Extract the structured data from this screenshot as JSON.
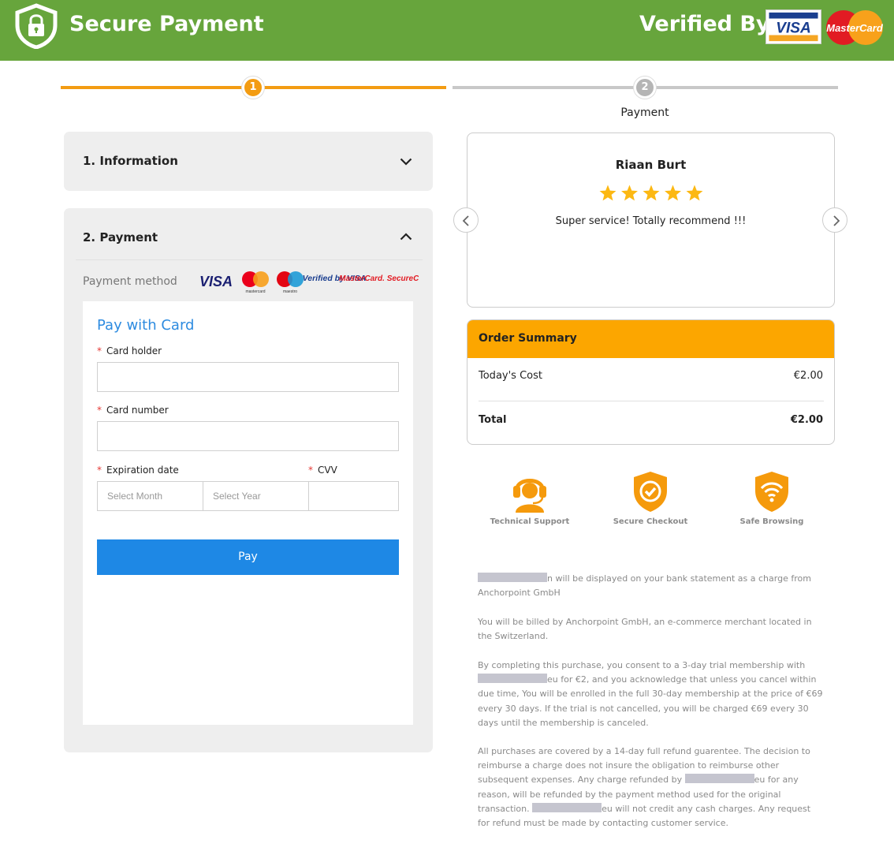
{
  "header": {
    "title": "Secure Payment",
    "verified_by": "Verified By",
    "visa_logo": "VISA",
    "mastercard_logo": "MasterCard",
    "color": "#67a53c"
  },
  "stepper": {
    "steps": [
      {
        "number": "1",
        "label": "",
        "state": "active",
        "color": "#f39c12"
      },
      {
        "number": "2",
        "label": "Payment",
        "state": "inactive",
        "color": "#bdbdbd"
      }
    ]
  },
  "accordion": {
    "information_title": "1. Information",
    "payment_title": "2. Payment",
    "payment_method_label": "Payment method",
    "method_logos": [
      "VISA",
      "mastercard",
      "maestro",
      "Verified by VISA",
      "MasterCard. SecureCode."
    ]
  },
  "card_form": {
    "title": "Pay with Card",
    "required_mark": "*",
    "card_holder_label": "Card holder",
    "card_holder_value": "",
    "card_number_label": "Card number",
    "card_number_value": "",
    "expiration_label": "Expiration date",
    "month_placeholder": "Select Month",
    "year_placeholder": "Select Year",
    "cvv_label": "CVV",
    "cvv_value": "",
    "pay_button": "Pay",
    "accent_color": "#1e88e5"
  },
  "review": {
    "name": "Riaan Burt",
    "rating": 5,
    "rating_max": 5,
    "text": "Super service! Totally recommend !!!"
  },
  "order_summary": {
    "title": "Order Summary",
    "rows": [
      {
        "label": "Today's Cost",
        "value": "€2.00"
      },
      {
        "label": "Total",
        "value": "€2.00"
      }
    ],
    "accent_color": "#fca600"
  },
  "badges": [
    {
      "icon": "support-headset-icon",
      "label": "Technical Support"
    },
    {
      "icon": "shield-check-icon",
      "label": "Secure Checkout"
    },
    {
      "icon": "wifi-shield-icon",
      "label": "Safe Browsing"
    }
  ],
  "legal": {
    "p1_tail": "n will be displayed on your bank statement as a charge from Anchorpoint GmbH",
    "p2": "You will be billed by Anchorpoint GmbH, an e-commerce merchant located in the Switzerland.",
    "p3_head": "By completing this purchase, you consent to a 3-day trial membership with",
    "p3_tail": "eu for €2, and you acknowledge that unless you cancel within due time, You will be enrolled in the full 30-day membership at the price of €69 every 30 days. If the trial is not cancelled, you will be charged €69 every 30 days until the membership is canceled.",
    "p4_head": "All purchases are covered by a 14-day full refund guarentee. The decision to reimburse a charge does not insure the obligation to reimburse other subsequent expenses. Any charge refunded by",
    "p4_mid": "eu for any reason, will be refunded by the payment method used for the original transaction.",
    "p4_tail": "eu will not credit any cash charges. Any request for refund must be made by contacting customer service."
  }
}
